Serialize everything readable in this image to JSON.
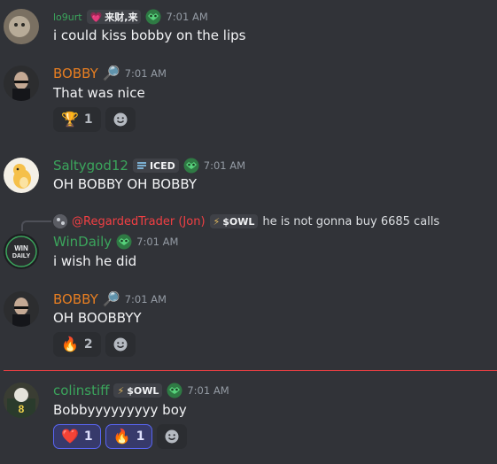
{
  "messages": [
    {
      "user": "lo9urt",
      "user_color": "#3ba55c",
      "tag": "来财,来",
      "tag_icon": "pink-heart-icon",
      "time": "7:01 AM",
      "text": "i could kiss bobby on the lips"
    },
    {
      "user": "BOBBY",
      "user_color": "#e67e22",
      "badge_icon": "magnifier-icon",
      "time": "7:01 AM",
      "text": "That was nice",
      "reactions": [
        {
          "emoji": "🏆",
          "count": "1"
        }
      ]
    },
    {
      "user": "Saltygod12",
      "user_color": "#3ba55c",
      "tag": "ICED",
      "tag_icon": "iced-icon",
      "time": "7:01 AM",
      "text": "OH BOBBY OH BOBBY"
    },
    {
      "reply_user": "@RegardedTrader (Jon)",
      "reply_tag": "$OWL",
      "reply_text": "he is not gonna buy 6685 calls",
      "user": "WinDaily",
      "user_color": "#3ba55c",
      "time": "7:01 AM",
      "text": "i wish he did"
    },
    {
      "user": "BOBBY",
      "user_color": "#e67e22",
      "badge_icon": "magnifier-icon",
      "time": "7:01 AM",
      "text": "OH BOOBBYY",
      "reactions": [
        {
          "emoji": "🔥",
          "count": "2"
        }
      ]
    },
    {
      "user": "colinstiff",
      "user_color": "#3ba55c",
      "tag": "$OWL",
      "tag_icon": "lightning-icon",
      "time": "7:01 AM",
      "text": "Bobbyyyyyyyyy boy",
      "reactions": [
        {
          "emoji": "❤️",
          "count": "1"
        },
        {
          "emoji": "🔥",
          "count": "1"
        }
      ]
    }
  ],
  "colors": {
    "background": "#313338",
    "reply_user": "#f23f43",
    "new_divider": "#f23f43",
    "badge_green": "#3ba55c"
  }
}
